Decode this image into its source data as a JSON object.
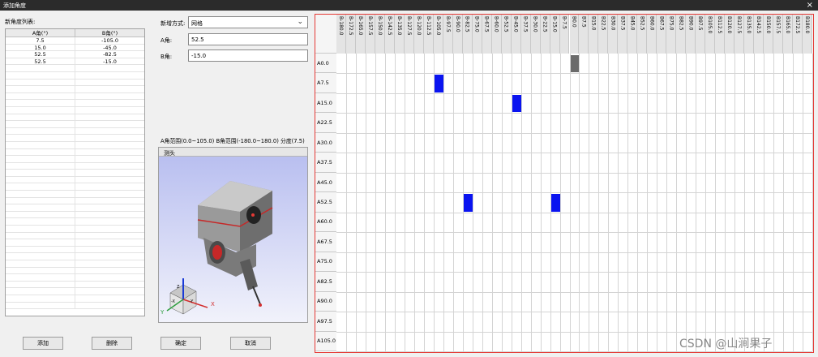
{
  "window": {
    "title": "添加角度",
    "close_glyph": "×"
  },
  "left": {
    "list_label": "新角度列表:",
    "headers": [
      "A角(°)",
      "B角(°)"
    ],
    "rows": [
      [
        "7.5",
        "-105.0"
      ],
      [
        "15.0",
        "-45.0"
      ],
      [
        "52.5",
        "-82.5"
      ],
      [
        "52.5",
        "-15.0"
      ]
    ]
  },
  "form": {
    "mode_label": "新增方式:",
    "mode_value": "网格",
    "a_label": "A角:",
    "a_value": "52.5",
    "b_label": "B角:",
    "b_value": "-15.0",
    "range_text": "A角范围(0.0~105.0) B角范围(-180.0~180.0) 分度(7.5)"
  },
  "probe": {
    "title": "测头",
    "axis_labels": {
      "x": "X",
      "y": "Y",
      "z": "Z"
    },
    "cube_labels": {
      "z": "Z",
      "x": "-X",
      "y": "-Y"
    }
  },
  "buttons": {
    "add": "添加",
    "delete": "删除",
    "ok": "确定",
    "cancel": "取消"
  },
  "grid": {
    "columns": [
      "B-180.0",
      "B-172.5",
      "B-165.0",
      "B-157.5",
      "B-150.0",
      "B-142.5",
      "B-135.0",
      "B-127.5",
      "B-120.0",
      "B-112.5",
      "B-105.0",
      "B-97.5",
      "B-90.0",
      "B-82.5",
      "B-75.0",
      "B-67.5",
      "B-60.0",
      "B-52.5",
      "B-45.0",
      "B-37.5",
      "B-30.0",
      "B-22.5",
      "B-15.0",
      "B-7.5",
      "B0.0",
      "B7.5",
      "B15.0",
      "B22.5",
      "B30.0",
      "B37.5",
      "B45.0",
      "B52.5",
      "B60.0",
      "B67.5",
      "B75.0",
      "B82.5",
      "B90.0",
      "B97.5",
      "B105.0",
      "B112.5",
      "B120.0",
      "B127.5",
      "B135.0",
      "B142.5",
      "B150.0",
      "B157.5",
      "B165.0",
      "B172.5",
      "B180.0"
    ],
    "rows": [
      "A0.0",
      "A7.5",
      "A15.0",
      "A22.5",
      "A30.0",
      "A37.5",
      "A45.0",
      "A52.5",
      "A60.0",
      "A67.5",
      "A75.0",
      "A82.5",
      "A90.0",
      "A97.5",
      "A105.0"
    ],
    "selected_color": "#0a14f0",
    "existing_color": "#6b6b6b",
    "cells": [
      {
        "a": "A0.0",
        "b": "B0.0",
        "state": "existing"
      },
      {
        "a": "A7.5",
        "b": "B-105.0",
        "state": "selected"
      },
      {
        "a": "A15.0",
        "b": "B-45.0",
        "state": "selected"
      },
      {
        "a": "A52.5",
        "b": "B-82.5",
        "state": "selected"
      },
      {
        "a": "A52.5",
        "b": "B-15.0",
        "state": "selected"
      }
    ]
  },
  "watermark": "CSDN @山涧果子"
}
